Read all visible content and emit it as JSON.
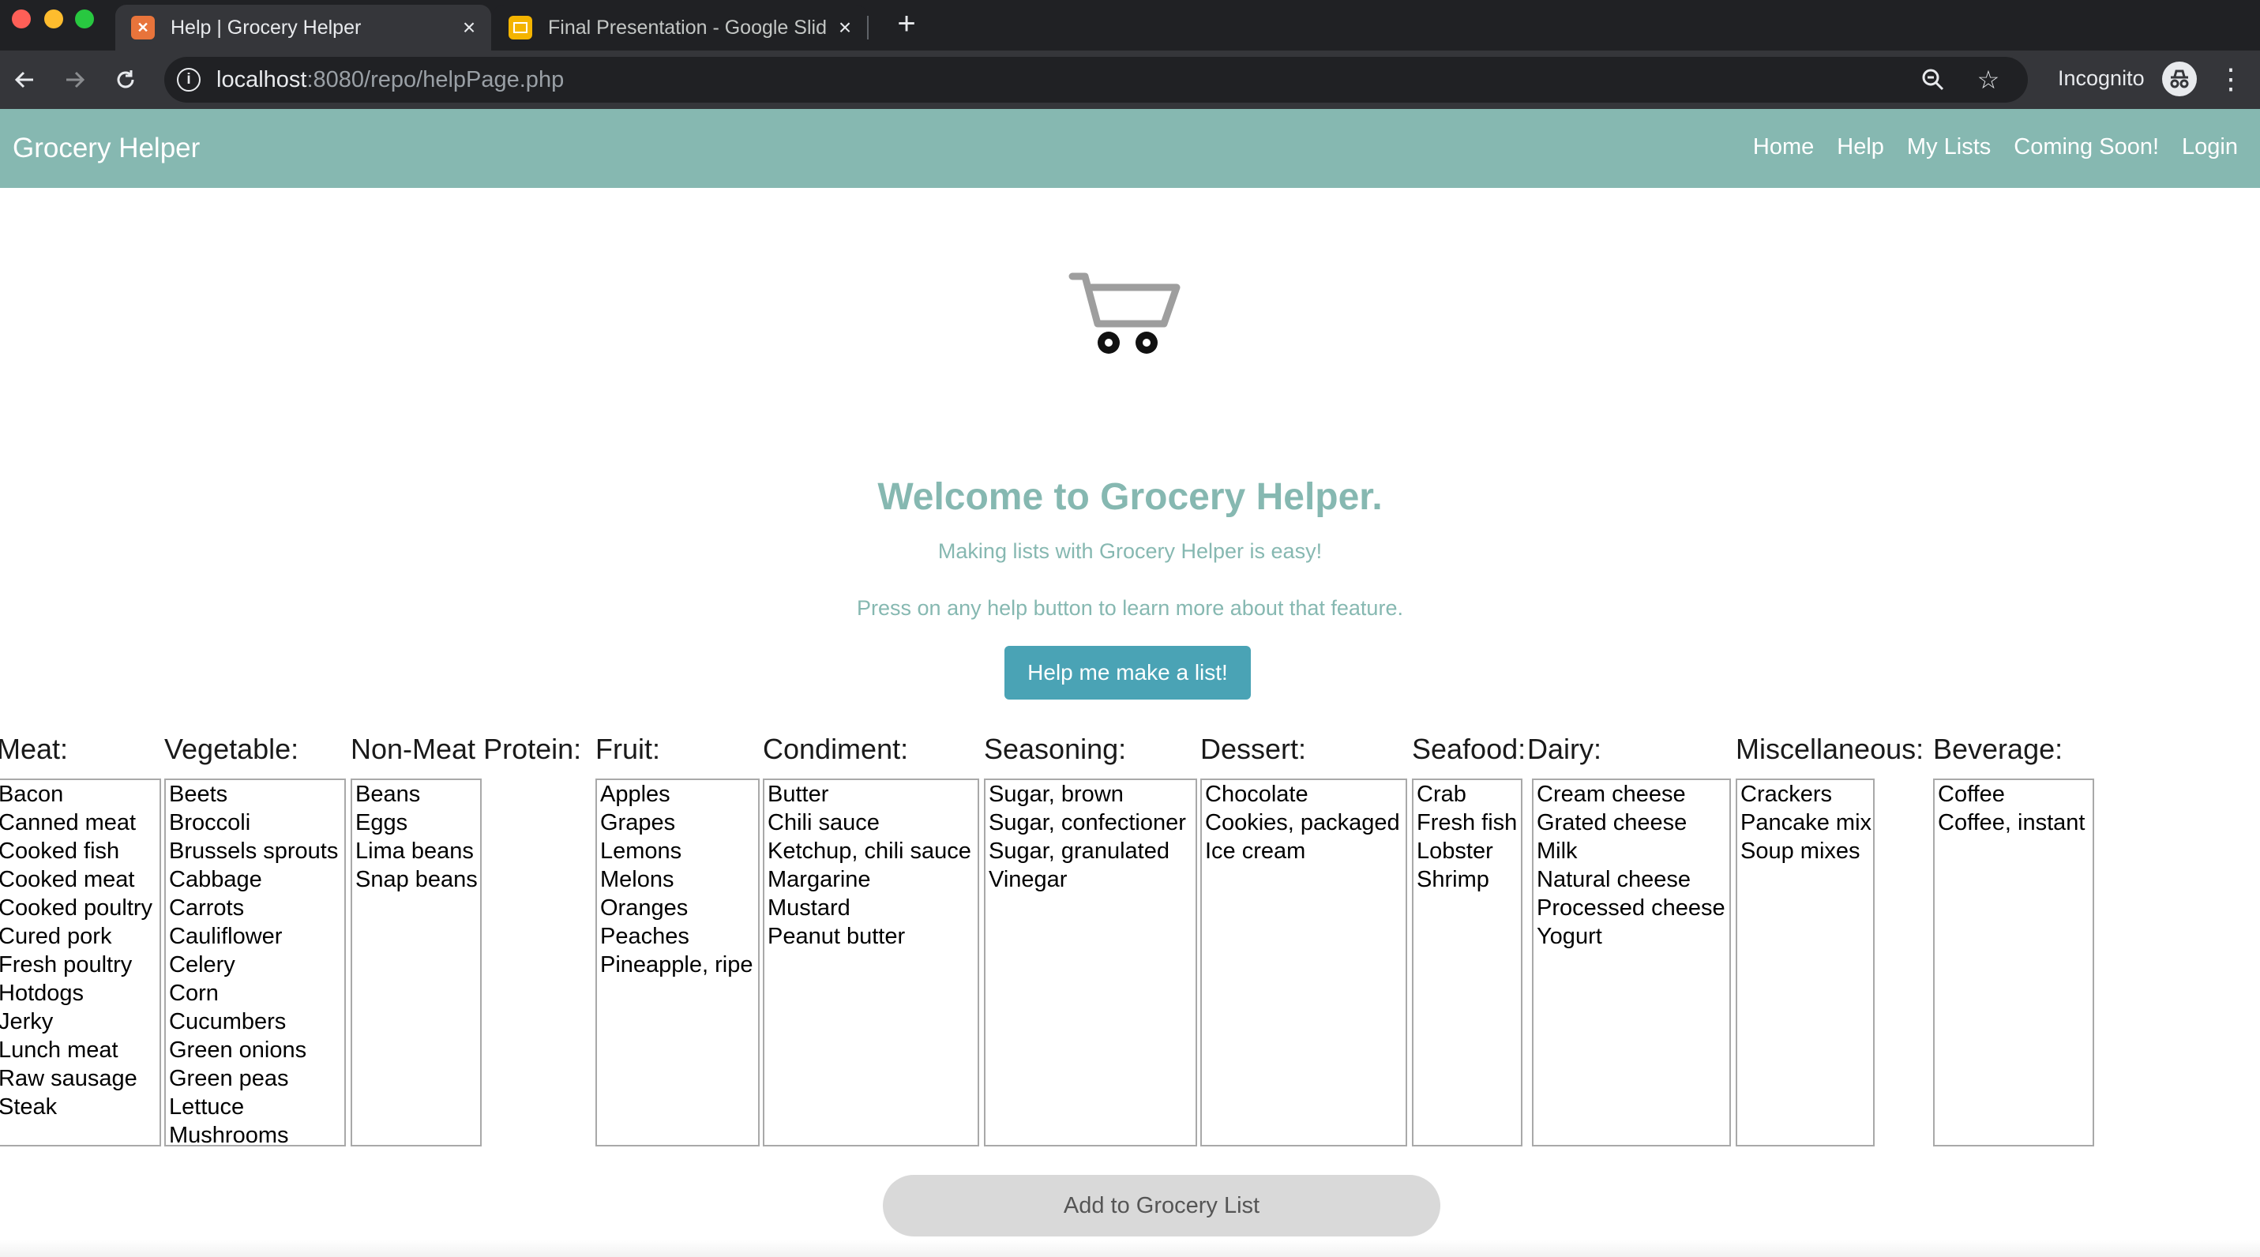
{
  "browser": {
    "tabs": [
      {
        "title": "Help | Grocery Helper",
        "icon": "grocery-favicon",
        "active": true
      },
      {
        "title": "Final Presentation - Google Slides",
        "icon": "slides-favicon",
        "active": false
      }
    ],
    "url_host": "localhost",
    "url_path": ":8080/repo/helpPage.php",
    "profile_label": "Incognito"
  },
  "navbar": {
    "brand": "Grocery Helper",
    "links": [
      "Home",
      "Help",
      "My Lists",
      "Coming Soon!",
      "Login"
    ],
    "background": "#86b8b1"
  },
  "hero": {
    "icon": "shopping-cart-icon",
    "title": "Welcome to Grocery Helper.",
    "subtitle": "Making lists with Grocery Helper is easy!",
    "instruction": "Press on any help button to learn more about that feature.",
    "help_button": "Help me make a list!"
  },
  "categories": [
    {
      "title": "Meat:",
      "items": [
        "Bacon",
        "Canned meat",
        "Cooked fish",
        "Cooked meat",
        "Cooked poultry",
        "Cured pork",
        "Fresh poultry",
        "Hotdogs",
        "Jerky",
        "Lunch meat",
        "Raw sausage",
        "Steak"
      ]
    },
    {
      "title": "Vegetable:",
      "items": [
        "Beets",
        "Broccoli",
        "Brussels sprouts",
        "Cabbage",
        "Carrots",
        "Cauliflower",
        "Celery",
        "Corn",
        "Cucumbers",
        "Green onions",
        "Green peas",
        "Lettuce",
        "Mushrooms"
      ]
    },
    {
      "title": "Non-Meat Protein:",
      "items": [
        "Beans",
        "Eggs",
        "Lima beans",
        "Snap beans"
      ]
    },
    {
      "title": "Fruit:",
      "items": [
        "Apples",
        "Grapes",
        "Lemons",
        "Melons",
        "Oranges",
        "Peaches",
        "Pineapple, ripe"
      ]
    },
    {
      "title": "Condiment:",
      "items": [
        "Butter",
        "Chili sauce",
        "Ketchup, chili sauce",
        "Margarine",
        "Mustard",
        "Peanut butter"
      ]
    },
    {
      "title": "Seasoning:",
      "items": [
        "Sugar, brown",
        "Sugar, confectioner",
        "Sugar, granulated",
        "Vinegar"
      ]
    },
    {
      "title": "Dessert:",
      "items": [
        "Chocolate",
        "Cookies, packaged",
        "Ice cream"
      ]
    },
    {
      "title": "Seafood:",
      "items": [
        "Crab",
        "Fresh fish",
        "Lobster",
        "Shrimp"
      ]
    },
    {
      "title": "Dairy:",
      "items": [
        "Cream cheese",
        "Grated cheese",
        "Milk",
        "Natural cheese",
        "Processed cheese",
        "Yogurt"
      ]
    },
    {
      "title": "Miscellaneous:",
      "items": [
        "Crackers",
        "Pancake mix",
        "Soup mixes"
      ]
    },
    {
      "title": "Beverage:",
      "items": [
        "Coffee",
        "Coffee, instant"
      ]
    }
  ],
  "add_button": "Add to Grocery List"
}
